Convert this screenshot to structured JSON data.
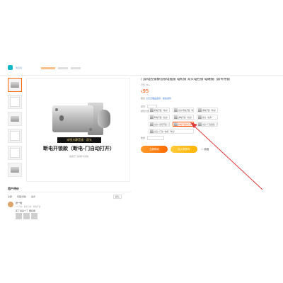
{
  "header": {
    "logo_text": "淘宝网"
  },
  "gallery": {
    "thumb_count": 6,
    "image_badge": "米悦方静音锁 · 双头",
    "image_title": "断电开锁款（断电-门自动打开）",
    "image_sub": "适用于门禁刷卡系统"
  },
  "product": {
    "title": "门禁电控锁静音锁电插锁 电机锁 双头电控锁 电磁锁门禁专用锁",
    "subtitle": "已售 50+",
    "price_symbol": "¥",
    "price_value": "95",
    "meta_prefix": "服务",
    "meta_value": "七天无理由退货 · 极速退款",
    "ship_label": "发货",
    "variant_label": "颜色分类",
    "quantity_label": "数量"
  },
  "variants": [
    {
      "label": "断电开锁（单头）",
      "selected": false,
      "wide": false
    },
    {
      "label": "双头 断电开锁（单头）",
      "selected": false,
      "wide": false
    },
    {
      "label": "通电开锁（单头）",
      "selected": false,
      "wide": false
    },
    {
      "label": "断电开锁（双头）",
      "selected": false,
      "wide": false
    },
    {
      "label": "通电开锁（双头）",
      "selected": false,
      "wide": false
    },
    {
      "label": "静音（双头）",
      "selected": false,
      "wide": false
    },
    {
      "label": "双头+遥控开锁（双头）",
      "selected": false,
      "wide": false
    },
    {
      "label": "断电开锁静音款",
      "selected": true,
      "wide": false
    },
    {
      "label": "双头+门禁套装（双头）",
      "selected": false,
      "wide": false
    },
    {
      "label": "双头+门禁一体机（单头）",
      "selected": false,
      "wide": true
    }
  ],
  "actions": {
    "buy_label": "立即购买",
    "cart_label": "加入购物车",
    "favorite_label": "收藏"
  },
  "reviews": {
    "section_title": "用户评价",
    "filters": [
      "全部",
      "有图/视频",
      "追评"
    ],
    "sort_label": "默认",
    "items": [
      {
        "user": "张**瑞",
        "meta": "1个月前 · 颜色分类：断电开锁",
        "text": "买了好多个了 很好用",
        "thumb_count": 3
      }
    ]
  },
  "colors": {
    "accent": "#ff5000",
    "buy_gradient_start": "#ff9a2e",
    "cart_gradient_start": "#ffcb3d",
    "annotation_arrow": "#e03a3a"
  }
}
